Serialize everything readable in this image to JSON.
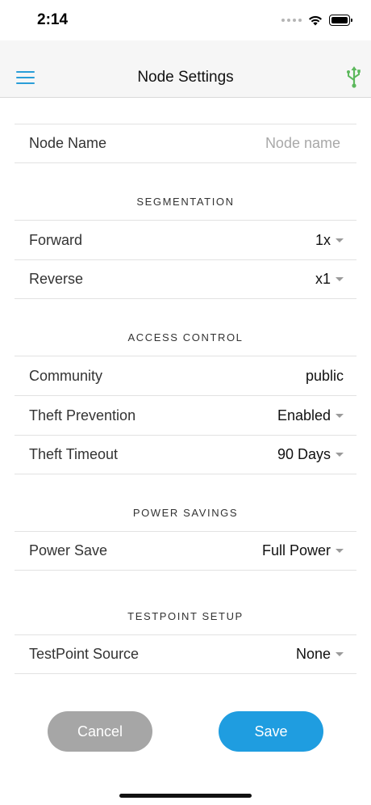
{
  "status_bar": {
    "time": "2:14"
  },
  "nav": {
    "title": "Node Settings",
    "menu_icon": "hamburger-menu-icon",
    "usb_icon": "usb-icon",
    "accent": "#2a9ed8",
    "usb_color": "#5cb85c"
  },
  "node_name": {
    "label": "Node Name",
    "placeholder": "Node name",
    "value": ""
  },
  "segmentation": {
    "header": "SEGMENTATION",
    "forward": {
      "label": "Forward",
      "value": "1x"
    },
    "reverse": {
      "label": "Reverse",
      "value": "x1"
    }
  },
  "access_control": {
    "header": "ACCESS CONTROL",
    "community": {
      "label": "Community",
      "value": "public"
    },
    "theft_prevention": {
      "label": "Theft Prevention",
      "value": "Enabled"
    },
    "theft_timeout": {
      "label": "Theft Timeout",
      "value": "90 Days"
    }
  },
  "power_savings": {
    "header": "POWER SAVINGS",
    "power_save": {
      "label": "Power Save",
      "value": "Full Power"
    }
  },
  "testpoint_setup": {
    "header": "TESTPOINT SETUP",
    "testpoint_source": {
      "label": "TestPoint Source",
      "value": "None"
    }
  },
  "buttons": {
    "cancel": "Cancel",
    "save": "Save",
    "cancel_color": "#a6a6a6",
    "save_color": "#1f9de0"
  }
}
